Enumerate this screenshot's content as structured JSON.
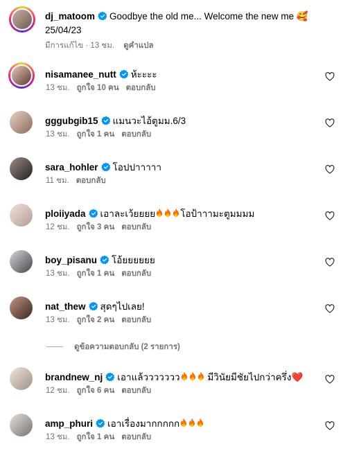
{
  "caption": {
    "username": "dj_matoom",
    "text": "Goodbye the old me... Welcome the new me 🥰",
    "date": "25/04/23",
    "edited": "มีการแก้ไข · 13 ชม.",
    "translate": "ดูคำแปล"
  },
  "comments": [
    {
      "username": "nisamanee_nutt",
      "text": "ห้ะะะะ",
      "time": "13 ชม.",
      "likes": "ถูกใจ 10 คน",
      "reply": "ตอบกลับ",
      "fires": 0,
      "text_after": ""
    },
    {
      "username": "gggubgib15",
      "text": "แมนวะไอ้ตูมม.6/3",
      "time": "13 ชม.",
      "likes": "ถูกใจ 1 คน",
      "reply": "ตอบกลับ",
      "fires": 0,
      "text_after": ""
    },
    {
      "username": "sara_hohler",
      "text": "โอปปาาาาา",
      "time": "11 ชม.",
      "likes": "",
      "reply": "ตอบกลับ",
      "fires": 0,
      "text_after": ""
    },
    {
      "username": "ploiiyada",
      "text": "เอาละเว้ยยยย",
      "time": "12 ชม.",
      "likes": "ถูกใจ 3 คน",
      "reply": "ตอบกลับ",
      "fires": 3,
      "text_after": "โอป้าาามะตูมมมม"
    },
    {
      "username": "boy_pisanu",
      "text": "โอ้ยยยยยย",
      "time": "13 ชม.",
      "likes": "ถูกใจ 1 คน",
      "reply": "ตอบกลับ",
      "fires": 0,
      "text_after": ""
    },
    {
      "username": "nat_thew",
      "text": "สุดๆไปเลย!",
      "time": "13 ชม.",
      "likes": "ถูกใจ 2 คน",
      "reply": "ตอบกลับ",
      "fires": 0,
      "text_after": ""
    },
    {
      "username": "brandnew_nj",
      "text": "เอาแล้ววววววว",
      "time": "12 ชม.",
      "likes": "ถูกใจ 6 คน",
      "reply": "ตอบกลับ",
      "fires": 3,
      "text_after": " มีวินัยมีชัยไปกว่าครึ่ง❤️"
    },
    {
      "username": "amp_phuri",
      "text": "เอาเรื่องมากกกกก",
      "time": "13 ชม.",
      "likes": "ถูกใจ 1 คน",
      "reply": "ตอบกลับ",
      "fires": 3,
      "text_after": ""
    }
  ],
  "view_replies": "ดูข้อความตอบกลับ (2 รายการ)",
  "colors": {
    "verified": "#0095f6",
    "muted": "#737373",
    "fire": "#ff6a00"
  }
}
